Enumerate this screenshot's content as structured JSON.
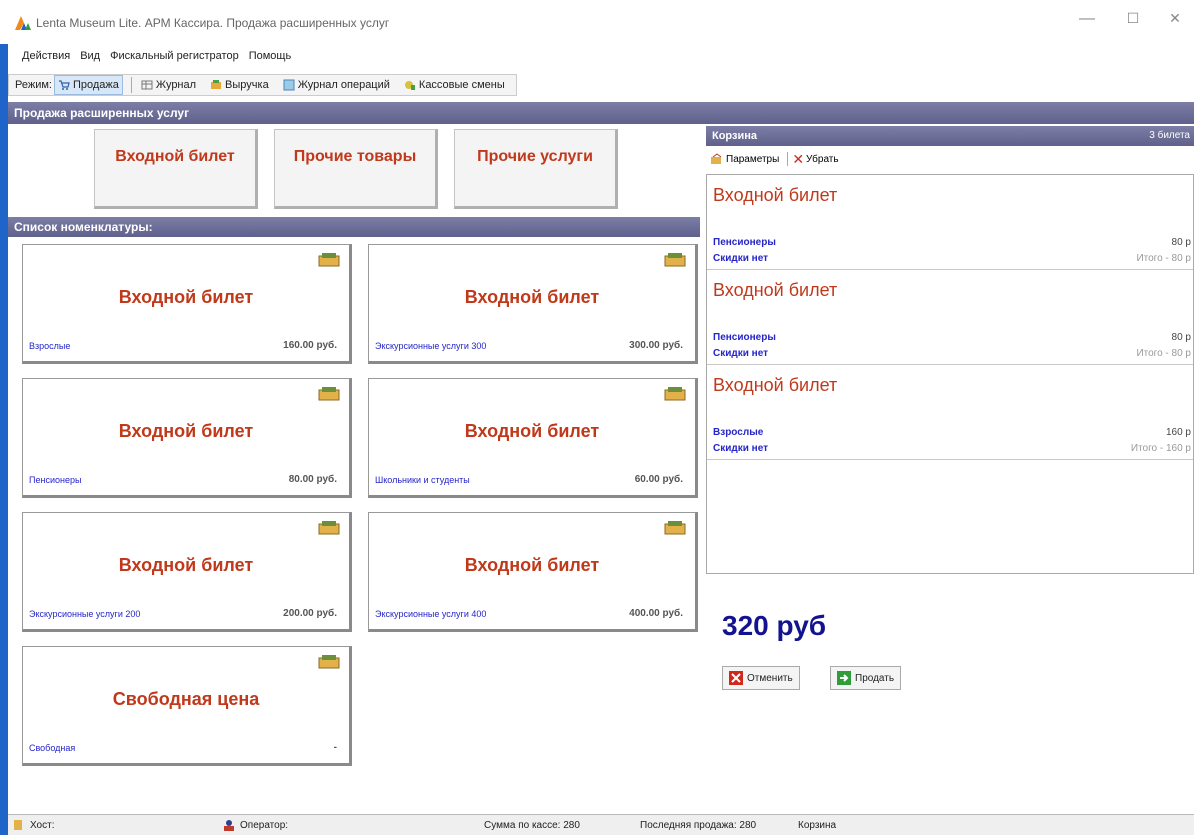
{
  "window": {
    "title": "Lenta Museum Lite. АРМ Кассира. Продажа расширенных услуг",
    "minimize": "—",
    "maximize": "☐",
    "close": "✕"
  },
  "menu": [
    "Действия",
    "Вид",
    "Фискальный регистратор",
    "Помощь"
  ],
  "toolbar": {
    "mode_label": "Режим:",
    "items": [
      {
        "label": "Продажа",
        "icon": "cart-icon",
        "active": true
      },
      {
        "label": "Журнал",
        "icon": "journal-icon",
        "active": false
      },
      {
        "label": "Выручка",
        "icon": "revenue-icon",
        "active": false
      },
      {
        "label": "Журнал операций",
        "icon": "operations-log-icon",
        "active": false
      },
      {
        "label": "Кассовые смены",
        "icon": "cash-shift-icon",
        "active": false
      }
    ]
  },
  "section_header": "Продажа расширенных услуг",
  "categories": [
    "Входной билет",
    "Прочие товары",
    "Прочие услуги"
  ],
  "nomenclature_header": "Список номенклатуры:",
  "products": [
    {
      "title": "Входной билет",
      "category": "Взрослые",
      "price": "160.00 руб."
    },
    {
      "title": "Входной билет",
      "category": "Экскурсионные услуги 300",
      "price": "300.00 руб."
    },
    {
      "title": "Входной билет",
      "category": "Пенсионеры",
      "price": "80.00 руб."
    },
    {
      "title": "Входной билет",
      "category": "Школьники и студенты",
      "price": "60.00 руб."
    },
    {
      "title": "Входной билет",
      "category": "Экскурсионные услуги 200",
      "price": "200.00 руб."
    },
    {
      "title": "Входной билет",
      "category": "Экскурсионные услуги 400",
      "price": "400.00 руб."
    },
    {
      "title": "Свободная цена",
      "category": "Свободная",
      "price": "-"
    }
  ],
  "cart": {
    "header": "Корзина",
    "count": "3 билета",
    "params_label": "Параметры",
    "remove_label": "Убрать",
    "items": [
      {
        "title": "Входной билет",
        "category": "Пенсионеры",
        "discount": "Скидки нет",
        "price": "80 р",
        "total": "Итого - 80 р"
      },
      {
        "title": "Входной билет",
        "category": "Пенсионеры",
        "discount": "Скидки нет",
        "price": "80 р",
        "total": "Итого - 80 р"
      },
      {
        "title": "Входной билет",
        "category": "Взрослые",
        "discount": "Скидки нет",
        "price": "160 р",
        "total": "Итого - 160 р"
      }
    ]
  },
  "total": "320 руб",
  "actions": {
    "cancel": "Отменить",
    "sell": "Продать"
  },
  "status": {
    "host": "Хост:",
    "operator": "Оператор:",
    "cash_sum": "Сумма по кассе: 280",
    "last_sale": "Последняя продажа: 280",
    "cart": "Корзина"
  },
  "colors": {
    "accent": "#1f64c8",
    "header": "#6a6c96",
    "title_red": "#c0391b",
    "link_blue": "#2525c8",
    "total_blue": "#13138f"
  }
}
